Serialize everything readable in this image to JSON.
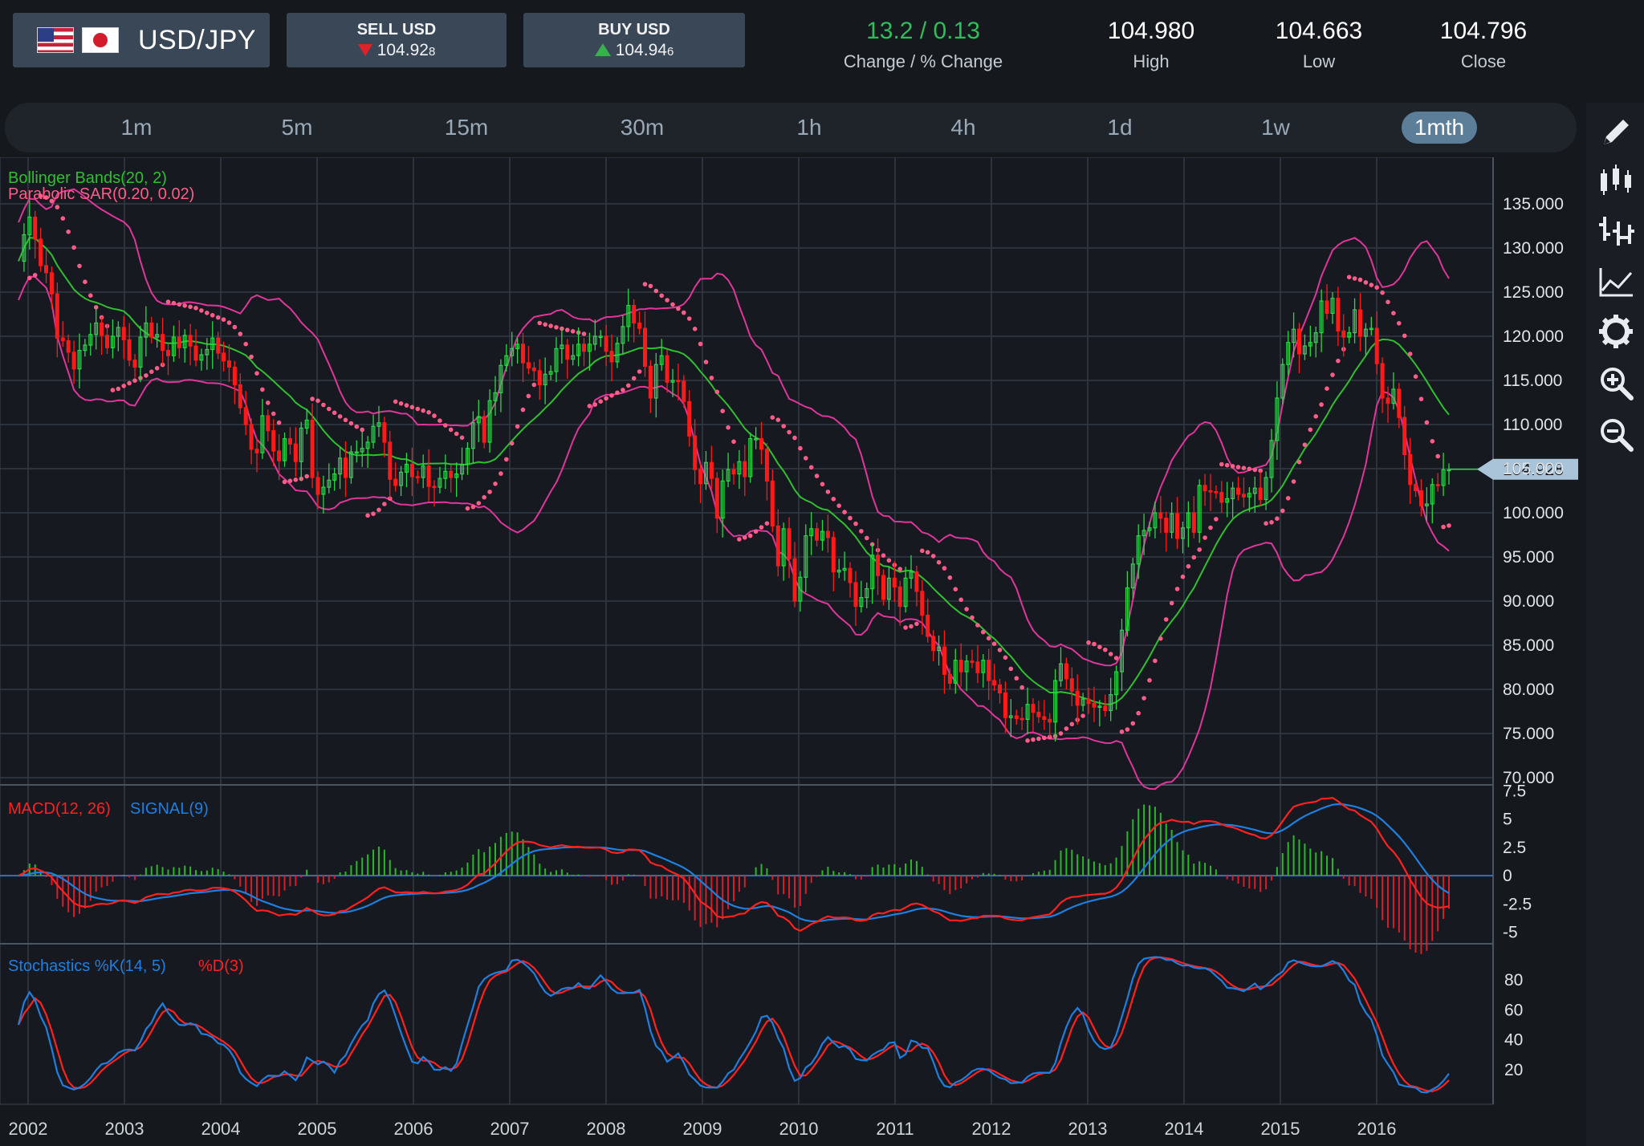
{
  "header": {
    "pair": "USD/JPY",
    "sell": {
      "label": "SELL USD",
      "price_main": "104.92",
      "price_pip": "8"
    },
    "buy": {
      "label": "BUY USD",
      "price_main": "104.94",
      "price_pip": "6"
    },
    "change": {
      "value": "13.2 / 0.13",
      "label": "Change / % Change"
    },
    "high": {
      "value": "104.980",
      "label": "High"
    },
    "low": {
      "value": "104.663",
      "label": "Low"
    },
    "close": {
      "value": "104.796",
      "label": "Close"
    }
  },
  "timeframes": {
    "items": [
      "1m",
      "5m",
      "15m",
      "30m",
      "1h",
      "4h",
      "1d",
      "1w",
      "1mth"
    ],
    "active": "1mth"
  },
  "toolbar": {
    "tools": [
      "pencil-icon",
      "candlestick-icon",
      "ohlc-bars-icon",
      "line-chart-icon",
      "settings-gear-icon",
      "zoom-in-icon",
      "zoom-out-icon"
    ]
  },
  "colors": {
    "up_candle": "#2bd64a",
    "down_candle": "#ff1a1a",
    "bollinger_outer": "#e0359a",
    "bollinger_mid": "#2fbf2f",
    "sar": "#ff5c8a",
    "macd": "#ff2020",
    "signal": "#1e7fe0",
    "histogram_pos": "#28b828",
    "histogram_neg": "#d81e2a",
    "stoch_k": "#1e7fe0",
    "stoch_d": "#ff2020",
    "price_tag": "#a9c3d8"
  },
  "chart_data": [
    {
      "type": "candlestick",
      "title": "",
      "indicators": [
        "Bollinger Bands(20, 2)",
        "Parabolic SAR(0.20, 0.02)"
      ],
      "ylim": [
        69,
        137
      ],
      "y_ticks": [
        "135.000",
        "130.000",
        "125.000",
        "120.000",
        "115.000",
        "110.000",
        "105.000",
        "100.000",
        "95.000",
        "90.000",
        "85.000",
        "80.000",
        "75.000",
        "70.000"
      ],
      "x_ticks": [
        "2002",
        "2003",
        "2004",
        "2005",
        "2006",
        "2007",
        "2008",
        "2009",
        "2010",
        "2011",
        "2012",
        "2013",
        "2014",
        "2015",
        "2016"
      ],
      "current_price": "104.928",
      "series": [
        {
          "name": "Close",
          "x_start": 2001.9,
          "x_end": 2016.75,
          "values": [
            128.5,
            131.5,
            133.5,
            131.0,
            128.0,
            127.2,
            124.8,
            119.8,
            119.5,
            118.2,
            116.3,
            118.4,
            119.0,
            120.2,
            121.5,
            120.1,
            118.7,
            120.0,
            121.0,
            119.6,
            117.3,
            116.5,
            119.9,
            121.5,
            119.9,
            120.2,
            118.4,
            117.8,
            119.9,
            118.7,
            120.1,
            118.9,
            117.3,
            117.9,
            118.5,
            119.8,
            118.1,
            117.2,
            116.5,
            114.5,
            111.9,
            110.0,
            107.2,
            106.8,
            111.0,
            109.3,
            107.0,
            105.9,
            108.4,
            107.8,
            105.8,
            109.6,
            110.5,
            104.0,
            102.1,
            102.9,
            103.7,
            104.4,
            106.2,
            104.0,
            106.9,
            106.9,
            107.3,
            108.0,
            109.8,
            110.2,
            108.0,
            103.8,
            103.1,
            104.6,
            105.5,
            104.1,
            104.0,
            105.3,
            103.0,
            102.9,
            103.9,
            104.7,
            104.0,
            104.4,
            105.5,
            107.3,
            110.2,
            110.9,
            108.0,
            112.7,
            113.6,
            116.7,
            117.8,
            118.6,
            119.1,
            117.0,
            116.4,
            116.1,
            114.5,
            115.7,
            116.0,
            118.6,
            119.0,
            117.4,
            117.8,
            119.1,
            118.3,
            119.1,
            120.0,
            120.0,
            118.3,
            117.1,
            119.2,
            121.1,
            123.5,
            121.5,
            120.9,
            116.6,
            113.0,
            116.8,
            117.8,
            114.8,
            115.0,
            114.9,
            112.6,
            108.7,
            104.9,
            103.3,
            105.7,
            103.9,
            99.4,
            103.6,
            104.9,
            104.4,
            105.8,
            104.1,
            108.4,
            108.4,
            107.2,
            103.6,
            98.5,
            94.0,
            98.2,
            94.8,
            90.0,
            92.7,
            97.4,
            98.2,
            96.9,
            97.9,
            97.2,
            93.3,
            93.5,
            93.7,
            92.1,
            89.4,
            90.4,
            91.4,
            95.2,
            92.9,
            90.2,
            92.6,
            91.6,
            89.4,
            92.6,
            93.3,
            91.1,
            88.4,
            86.0,
            84.4,
            84.8,
            81.7,
            80.7,
            83.3,
            82.0,
            83.2,
            83.1,
            81.9,
            83.3,
            81.0,
            80.5,
            79.6,
            76.8,
            77.0,
            76.7,
            76.6,
            78.3,
            77.4,
            76.9,
            76.6,
            76.3,
            81.0,
            82.9,
            81.2,
            79.8,
            78.2,
            78.9,
            78.4,
            78.0,
            78.1,
            77.6,
            79.4,
            82.0,
            86.7,
            91.5,
            94.2,
            97.4,
            98.0,
            98.3,
            100.0,
            99.4,
            97.8,
            99.9,
            97.1,
            98.3,
            100.0,
            97.8,
            103.1,
            102.5,
            102.4,
            102.3,
            101.2,
            101.6,
            102.8,
            102.1,
            101.8,
            102.2,
            102.8,
            101.5,
            104.0,
            108.2,
            113.0,
            116.8,
            119.3,
            120.8,
            118.0,
            118.9,
            119.3,
            120.4,
            124.0,
            122.6,
            124.3,
            120.6,
            119.9,
            120.4,
            123.0,
            120.0,
            120.8,
            120.9,
            116.9,
            113.0,
            112.4,
            114.0,
            110.8,
            106.6,
            103.2,
            102.5,
            100.8,
            101.0,
            103.2,
            103.1,
            104.9,
            104.9
          ]
        },
        {
          "name": "Bollinger Bands(20, 2)",
          "note": "upper, middle and lower bands"
        },
        {
          "name": "Parabolic SAR(0.20, 0.02)"
        }
      ]
    },
    {
      "type": "line",
      "indicators": [
        "MACD(12, 26)",
        "SIGNAL(9)"
      ],
      "ylim": [
        -5.6,
        7.6
      ],
      "y_ticks": [
        "7.5",
        "5",
        "2.5",
        "0",
        "-2.5",
        "-5"
      ],
      "series": [
        {
          "name": "MACD(12, 26)"
        },
        {
          "name": "SIGNAL(9)"
        }
      ]
    },
    {
      "type": "line",
      "indicators": [
        "Stochastics %K(14, 5)",
        "%D(3)"
      ],
      "ylim": [
        0,
        100
      ],
      "y_ticks": [
        "80",
        "60",
        "40",
        "20"
      ],
      "series": [
        {
          "name": "Stochastics %K(14, 5)"
        },
        {
          "name": "%D(3)"
        }
      ]
    }
  ]
}
